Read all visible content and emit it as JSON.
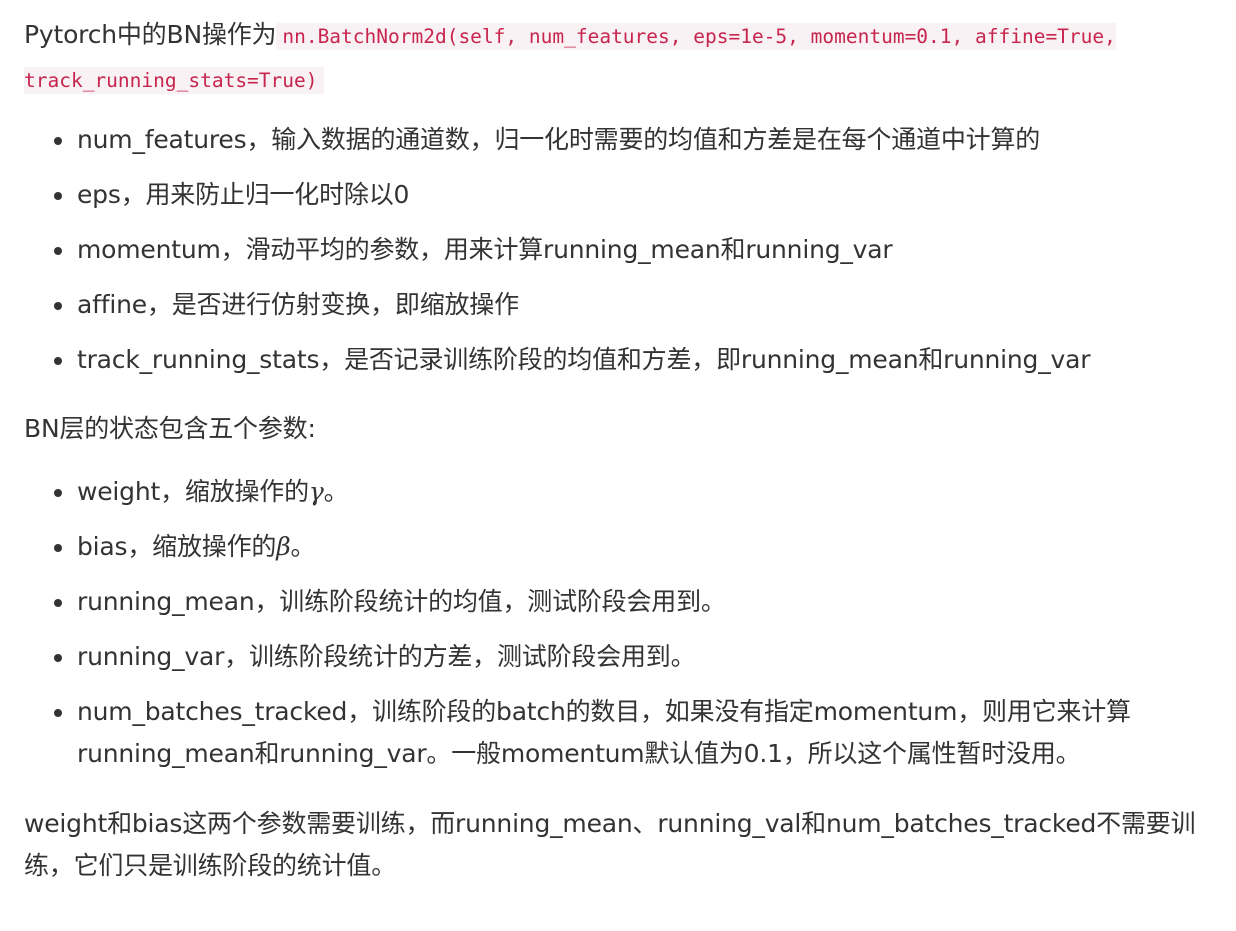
{
  "intro": {
    "text": "Pytorch中的BN操作为",
    "code": "nn.BatchNorm2d(self, num_features, eps=1e-5, momentum=0.1, affine=True, track_running_stats=True)"
  },
  "params": [
    {
      "name": "num_features",
      "desc": "，输入数据的通道数，归一化时需要的均值和方差是在每个通道中计算的"
    },
    {
      "name": "eps",
      "desc": "，用来防止归一化时除以0"
    },
    {
      "name": "momentum",
      "desc": "，滑动平均的参数，用来计算running_mean和running_var"
    },
    {
      "name": "affine",
      "desc": "，是否进行仿射变换，即缩放操作"
    },
    {
      "name": "track_running_stats",
      "desc": "，是否记录训练阶段的均值和方差，即running_mean和running_var"
    }
  ],
  "state_intro": "BN层的状态包含五个参数:",
  "state": [
    {
      "name": "weight",
      "desc": "，缩放操作的",
      "symbol": "γ",
      "suffix": "。"
    },
    {
      "name": "bias",
      "desc": "，缩放操作的",
      "symbol": "β",
      "suffix": "。"
    },
    {
      "name": "running_mean",
      "desc": "，训练阶段统计的均值，测试阶段会用到。"
    },
    {
      "name": "running_var",
      "desc": "，训练阶段统计的方差，测试阶段会用到。"
    },
    {
      "name": "num_batches_tracked",
      "desc": "，训练阶段的batch的数目，如果没有指定momentum，则用它来计算running_mean和running_var。一般momentum默认值为0.1，所以这个属性暂时没用。"
    }
  ],
  "summary": "weight和bias这两个参数需要训练，而running_mean、running_val和num_batches_tracked不需要训练，它们只是训练阶段的统计值。"
}
